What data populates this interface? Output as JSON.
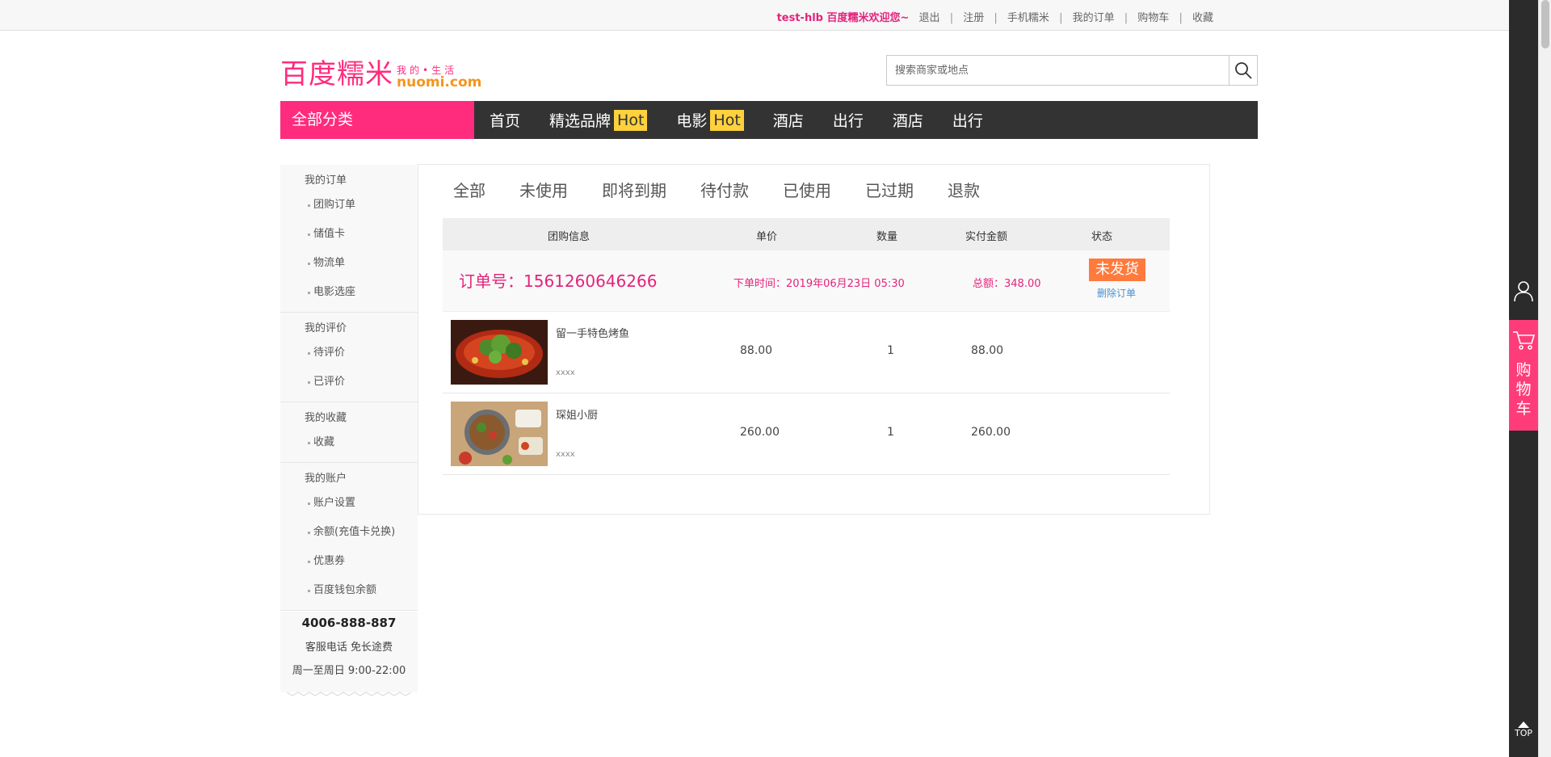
{
  "topbar": {
    "welcome": "test-hlb 百度糯米欢迎您~",
    "links": [
      "退出",
      "注册",
      "手机糯米",
      "我的订单",
      "购物车",
      "收藏"
    ]
  },
  "logo": {
    "cn": "百度糯米",
    "slogan": "我的•生活",
    "en": "nuomi.com"
  },
  "search": {
    "placeholder": "搜索商家或地点",
    "icon": "search-icon"
  },
  "nav": {
    "all_categories": "全部分类",
    "items": [
      {
        "label": "首页",
        "badge": ""
      },
      {
        "label": "精选品牌",
        "badge": "Hot"
      },
      {
        "label": "电影",
        "badge": "Hot"
      },
      {
        "label": "酒店",
        "badge": ""
      },
      {
        "label": "出行",
        "badge": ""
      },
      {
        "label": "酒店",
        "badge": ""
      },
      {
        "label": "出行",
        "badge": ""
      }
    ]
  },
  "sidebar": {
    "groups": [
      {
        "title": "我的订单",
        "items": [
          "团购订单",
          "储值卡",
          "物流单",
          "电影选座"
        ]
      },
      {
        "title": "我的评价",
        "items": [
          "待评价",
          "已评价"
        ]
      },
      {
        "title": "我的收藏",
        "items": [
          "收藏"
        ]
      },
      {
        "title": "我的账户",
        "items": [
          "账户设置",
          "余额(充值卡兑换)",
          "优惠券",
          "百度钱包余额"
        ]
      }
    ],
    "service": {
      "phone": "4006-888-887",
      "line1": "客服电话 免长途费",
      "line2": "周一至周日 9:00-22:00"
    }
  },
  "tabs": [
    "全部",
    "未使用",
    "即将到期",
    "待付款",
    "已使用",
    "已过期",
    "退款"
  ],
  "table": {
    "headers": {
      "info": "团购信息",
      "unit_price": "单价",
      "quantity": "数量",
      "paid": "实付金额",
      "status": "状态"
    }
  },
  "order": {
    "number_label": "订单号：",
    "number": "1561260646266",
    "time": "下单时间：2019年06月23日 05:30",
    "total": "总额：348.00",
    "status": "未发货",
    "delete": "删除订单",
    "items": [
      {
        "name": "留一手特色烤鱼",
        "sub": "xxxx",
        "price": "88.00",
        "qty": "1",
        "paid": "88.00"
      },
      {
        "name": "琛姐小厨",
        "sub": "xxxx",
        "price": "260.00",
        "qty": "1",
        "paid": "260.00"
      }
    ]
  },
  "right_bar": {
    "user_icon": "user-icon",
    "cart_icon": "cart-icon",
    "cart_label": "购物车",
    "top_label": "TOP"
  },
  "colors": {
    "brand_pink": "#ff2b7d",
    "order_pink": "#e4237c",
    "hot_yellow": "#ffd13c",
    "status_orange": "#ff7a3d",
    "nav_dark": "#333333"
  }
}
